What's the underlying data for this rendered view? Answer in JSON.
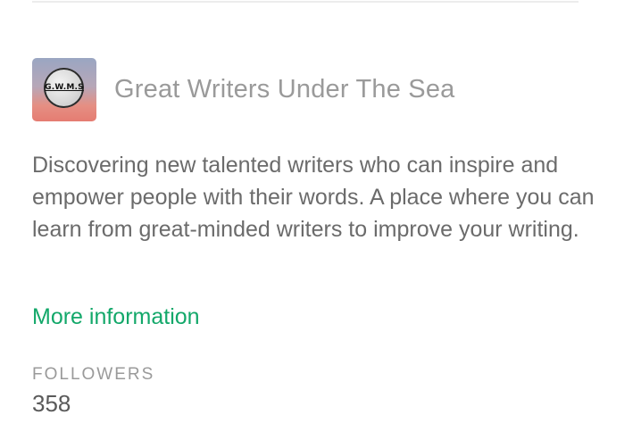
{
  "publication": {
    "logo_text": "G.W.M.S",
    "name": "Great Writers Under The Sea",
    "description": "Discovering new talented writers who can inspire and empower people with their words. A place where you can learn from great-minded writers to improve your writing.",
    "more_info_label": "More information"
  },
  "stats": {
    "followers_label": "FOLLOWERS",
    "followers_count": "358"
  },
  "colors": {
    "link_green": "#13a86a",
    "title_gray": "#9a9a9a",
    "body_text": "#6b6b6b"
  }
}
